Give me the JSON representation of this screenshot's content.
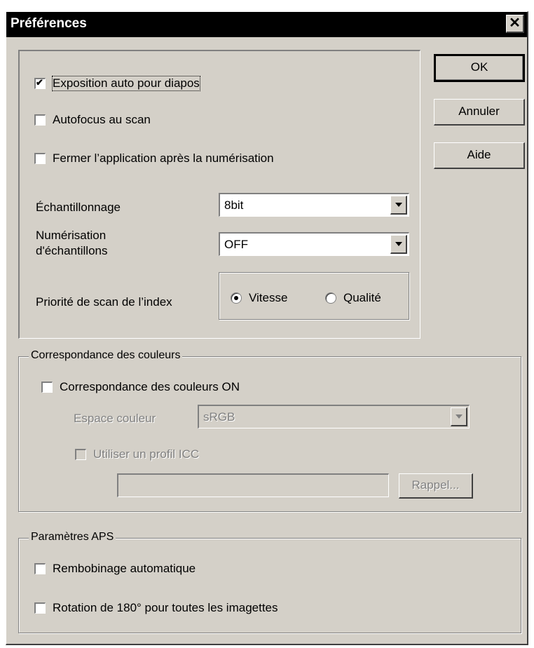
{
  "window": {
    "title": "Préférences",
    "close": "✕"
  },
  "buttons": {
    "ok": "OK",
    "cancel": "Annuler",
    "help": "Aide"
  },
  "general": {
    "auto_exposure": "Exposition auto pour diapos",
    "autofocus": "Autofocus au scan",
    "close_after": "Fermer l’application après la numérisation",
    "sampling_label": "Échantillonnage",
    "sampling_value": "8bit",
    "sample_scan_label_1": "Numérisation",
    "sample_scan_label_2": "d'échantillons",
    "sample_scan_value": "OFF",
    "index_priority_label": "Priorité de scan de l’index",
    "speed": "Vitesse",
    "quality": "Qualité"
  },
  "color": {
    "group_title": "Correspondance des couleurs",
    "enable": "Correspondance des couleurs ON",
    "space_label": "Espace couleur",
    "space_value": "sRGB",
    "use_icc": "Utiliser un profil ICC",
    "icc_path": "",
    "browse": "Rappel..."
  },
  "aps": {
    "group_title": "Paramètres APS",
    "rewind": "Rembobinage automatique",
    "rotate": "Rotation de 180° pour toutes les imagettes"
  },
  "state": {
    "auto_exposure_checked": true,
    "autofocus_checked": false,
    "close_after_checked": false,
    "priority": "Vitesse",
    "color_enabled": false,
    "icc_enabled": false,
    "rewind_checked": false,
    "rotate_checked": false
  }
}
